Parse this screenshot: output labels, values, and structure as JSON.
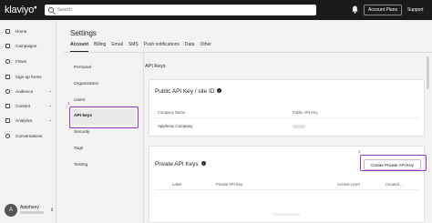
{
  "brand": {
    "logo_text": "klaviyo",
    "accent": "#9b33c6",
    "topbar_bg": "#1b1b1b"
  },
  "topbar": {
    "search_placeholder": "Search",
    "account_button": "Account Plans",
    "support_label": "Support",
    "bell_icon": "bell-icon"
  },
  "sidebar": {
    "items": [
      {
        "label": "Home",
        "icon": "home-icon"
      },
      {
        "label": "Campaigns",
        "icon": "campaigns-icon"
      },
      {
        "label": "Flows",
        "icon": "flows-icon"
      },
      {
        "label": "Sign-up forms",
        "icon": "forms-icon"
      },
      {
        "label": "Audience",
        "icon": "audience-icon",
        "has_chevron": true
      },
      {
        "label": "Content",
        "icon": "content-icon",
        "has_chevron": true
      },
      {
        "label": "Analytics",
        "icon": "analytics-icon",
        "has_chevron": true
      },
      {
        "label": "Conversations",
        "icon": "conversations-icon"
      }
    ],
    "account": {
      "avatar_letter": "A",
      "name": "Apipheny"
    }
  },
  "page": {
    "title": "Settings",
    "tabs": [
      {
        "label": "Account",
        "active": true
      },
      {
        "label": "Billing"
      },
      {
        "label": "Email"
      },
      {
        "label": "SMS"
      },
      {
        "label": "Push notifications"
      },
      {
        "label": "Data"
      },
      {
        "label": "Other"
      }
    ],
    "subnav": [
      {
        "label": "Personal"
      },
      {
        "label": "Organization"
      },
      {
        "label": "Users"
      },
      {
        "label": "API keys",
        "active": true
      },
      {
        "label": "Security"
      },
      {
        "label": "Tags"
      },
      {
        "label": "Testing"
      }
    ],
    "section_heading": "API Keys",
    "public_card": {
      "title": "Public API Key / site ID",
      "col_company": "Company Name",
      "col_key": "Public API Key",
      "company_value": "Apipheny Company"
    },
    "private_card": {
      "title": "Private API Keys",
      "create_button": "Create Private API Key",
      "columns": [
        "Label",
        "Private API Key",
        "Access Level",
        "Created ..."
      ]
    },
    "annotations": {
      "step1": "1",
      "step2": "2"
    }
  }
}
